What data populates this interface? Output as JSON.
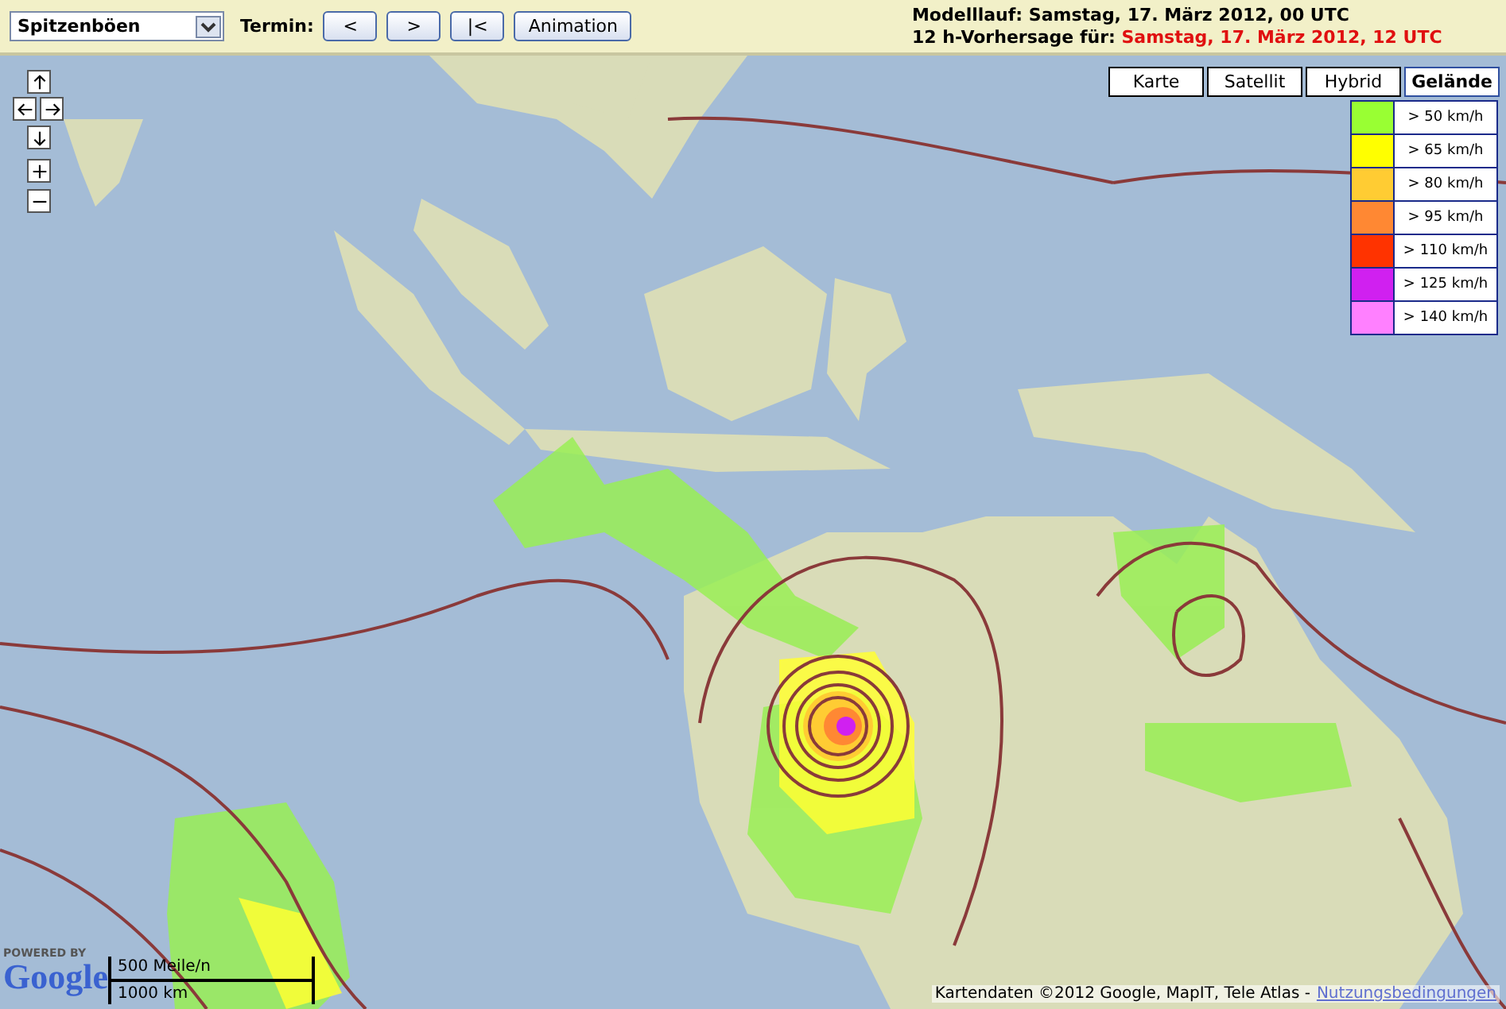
{
  "toolbar": {
    "product_select": {
      "value": "Spitzenböen"
    },
    "termin_label": "Termin:",
    "buttons": [
      {
        "label": "<"
      },
      {
        "label": ">"
      },
      {
        "label": "|<"
      },
      {
        "label": "Animation"
      }
    ],
    "model_run": {
      "label": "Modelllauf:",
      "value": "Samstag, 17. März 2012, 00 UTC"
    },
    "forecast": {
      "label": "12 h-Vorhersage für:",
      "value": "Samstag, 17. März 2012, 12 UTC"
    }
  },
  "map_types": [
    {
      "label": "Karte",
      "selected": false
    },
    {
      "label": "Satellit",
      "selected": false
    },
    {
      "label": "Hybrid",
      "selected": false
    },
    {
      "label": "Gelände",
      "selected": true
    }
  ],
  "legend": [
    {
      "label": "> 50 km/h",
      "color": "#99ff33"
    },
    {
      "label": "> 65 km/h",
      "color": "#ffff00"
    },
    {
      "label": "> 80 km/h",
      "color": "#ffcc33"
    },
    {
      "label": "> 95 km/h",
      "color": "#ff8833"
    },
    {
      "label": "> 110 km/h",
      "color": "#ff3300"
    },
    {
      "label": "> 125 km/h",
      "color": "#d020f0"
    },
    {
      "label": "> 140 km/h",
      "color": "#ff80ff"
    }
  ],
  "logo": {
    "caption": "POWERED BY",
    "name": "Google"
  },
  "scale": {
    "miles": "500 Meile/n",
    "km": "1000 km"
  },
  "attribution": {
    "text": "Kartendaten ©2012 Google, MapIT, Tele Atlas -",
    "link": "Nutzungsbedingungen"
  }
}
